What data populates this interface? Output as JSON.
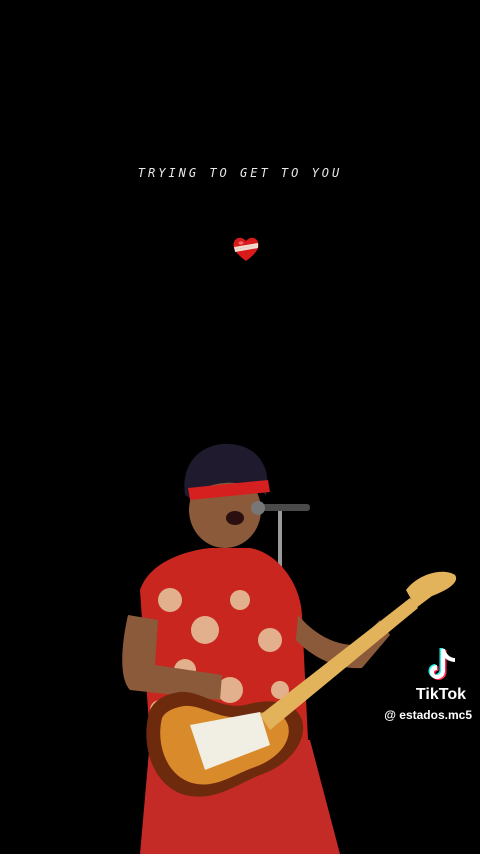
{
  "lyric": "TRYING TO GET TO YOU",
  "icons": {
    "heart": "bandaged-heart-icon",
    "logo": "tiktok-logo-icon"
  },
  "watermark": {
    "brand": "TikTok",
    "handle": "@ estados.mc5"
  },
  "colors": {
    "background": "#000000",
    "heart": "#d91a1a",
    "shirt": "#c8261e",
    "headband": "#d61f1f",
    "tiktok_cyan": "#25f4ee",
    "tiktok_pink": "#fe2c55"
  }
}
